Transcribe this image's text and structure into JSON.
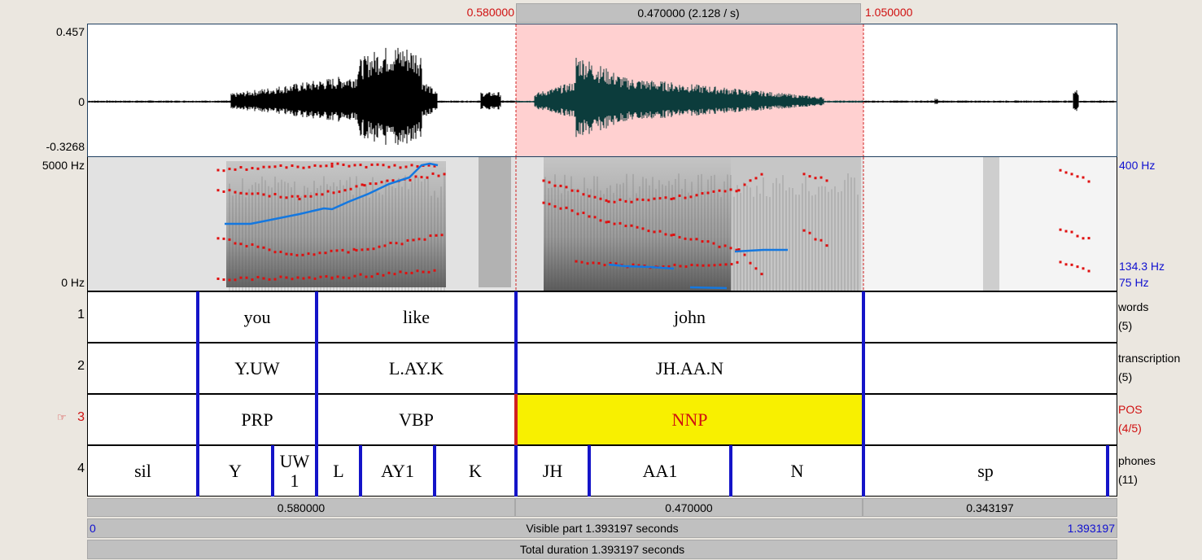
{
  "selection": {
    "start": "0.580000",
    "duration": "0.470000 (2.128 / s)",
    "end": "1.050000"
  },
  "waveform": {
    "y_max": "0.457",
    "y_zero": "0",
    "y_min": "-0.3268"
  },
  "spectrogram": {
    "freq_max": "5000 Hz",
    "freq_min": "0 Hz",
    "pitch_max": "400 Hz",
    "pitch_cursor": "134.3 Hz",
    "pitch_min": "75 Hz"
  },
  "tiers": [
    {
      "number": "1",
      "name": "words",
      "count": "(5)",
      "intervals": [
        "",
        "you",
        "like",
        "john",
        ""
      ]
    },
    {
      "number": "2",
      "name": "transcription",
      "count": "(5)",
      "intervals": [
        "",
        "Y.UW",
        "L.AY.K",
        "JH.AA.N",
        ""
      ]
    },
    {
      "number": "3",
      "name": "POS",
      "count": "(4/5)",
      "selected_marker": "☞",
      "intervals": [
        "",
        "PRP",
        "VBP",
        "NNP",
        ""
      ]
    },
    {
      "number": "4",
      "name": "phones",
      "count": "(11)",
      "intervals": [
        "sil",
        "Y",
        "UW\n1",
        "L",
        "AY1",
        "K",
        "JH",
        "AA1",
        "N",
        "sp"
      ]
    }
  ],
  "bottom": {
    "seg_left": "0.580000",
    "seg_mid": "0.470000",
    "seg_right": "0.343197",
    "visible_start": "0",
    "visible_label": "Visible part 1.393197 seconds",
    "visible_end": "1.393197",
    "total_label": "Total duration 1.393197 seconds"
  },
  "colors": {
    "selection_fill": "#ffd0d0",
    "boundary": "#1414c8",
    "formant": "#e01010",
    "pitch": "#1478e0",
    "pos_highlight": "#f8f000"
  }
}
